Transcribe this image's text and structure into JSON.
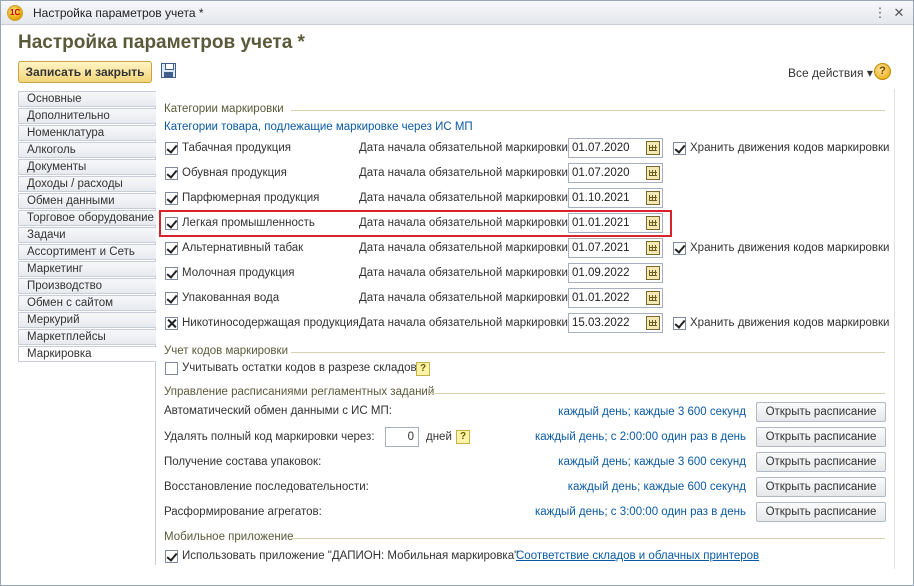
{
  "window": {
    "title": "Настройка параметров учета *",
    "app_logo": "1C"
  },
  "form": {
    "title": "Настройка параметров учета *",
    "save_close_label": "Записать и закрыть",
    "all_actions_label": "Все действия",
    "help_label": "?"
  },
  "sidebar": {
    "items": [
      {
        "label": "Основные"
      },
      {
        "label": "Дополнительно"
      },
      {
        "label": "Номенклатура"
      },
      {
        "label": "Алкоголь"
      },
      {
        "label": "Документы"
      },
      {
        "label": "Доходы / расходы"
      },
      {
        "label": "Обмен данными"
      },
      {
        "label": "Торговое оборудование"
      },
      {
        "label": "Задачи"
      },
      {
        "label": "Ассортимент и Сеть"
      },
      {
        "label": "Маркетинг"
      },
      {
        "label": "Производство"
      },
      {
        "label": "Обмен с сайтом"
      },
      {
        "label": "Меркурий"
      },
      {
        "label": "Маркетплейсы"
      },
      {
        "label": "Маркировка"
      }
    ],
    "active": "Маркировка"
  },
  "categories": {
    "header": "Категории маркировки",
    "subtitle": "Категории товара, подлежащие маркировке через ИС МП",
    "date_label": "Дата начала обязательной маркировки:",
    "store_label": "Хранить движения кодов маркировки",
    "rows": [
      {
        "label": "Табачная продукция",
        "date": "01.07.2020",
        "checked": true,
        "store": true
      },
      {
        "label": "Обувная продукция",
        "date": "01.07.2020",
        "checked": true,
        "store": false
      },
      {
        "label": "Парфюмерная продукция",
        "date": "01.10.2021",
        "checked": true,
        "store": false
      },
      {
        "label": "Легкая промышленность",
        "date": "01.01.2021",
        "checked": true,
        "store": false,
        "highlighted": true
      },
      {
        "label": "Альтернативный табак",
        "date": "01.07.2021",
        "checked": true,
        "store": true
      },
      {
        "label": "Молочная продукция",
        "date": "01.09.2022",
        "checked": true,
        "store": false
      },
      {
        "label": "Упакованная вода",
        "date": "01.01.2022",
        "checked": true,
        "store": false
      },
      {
        "label": "Никотиносодержащая продукция",
        "date": "15.03.2022",
        "checked": true,
        "store": true
      }
    ]
  },
  "codes": {
    "header": "Учет кодов маркировки",
    "by_warehouse_label": "Учитывать остатки кодов в разрезе складов",
    "by_warehouse_checked": false,
    "hint": "?"
  },
  "schedules": {
    "header": "Управление расписаниями регламентных заданий",
    "open_label": "Открыть расписание",
    "days_label": "дней",
    "days_value": "0",
    "hint": "?",
    "rows": [
      {
        "label": "Автоматический обмен данными с ИС МП:",
        "schedule": "каждый день; каждые 3 600 секунд"
      },
      {
        "label": "Удалять полный код маркировки через:",
        "schedule": "каждый день; с 2:00:00 один раз в день"
      },
      {
        "label": "Получение состава упаковок:",
        "schedule": "каждый день; каждые 3 600 секунд"
      },
      {
        "label": "Восстановление последовательности:",
        "schedule": "каждый день; каждые 600 секунд"
      },
      {
        "label": "Расформирование агрегатов:",
        "schedule": "каждый день; с 3:00:00 один раз в день"
      }
    ]
  },
  "mobile": {
    "header": "Мобильное приложение",
    "use_app_label": "Использовать приложение \"ДАПИОН: Мобильная маркировка\"",
    "use_app_checked": true,
    "link_label": "Соответствие складов и облачных принтеров"
  },
  "colors": {
    "accent_button": "#f2d57a",
    "link": "#0b5aa6",
    "highlight_border": "#d8232a",
    "group_header": "#5a5a3a"
  }
}
